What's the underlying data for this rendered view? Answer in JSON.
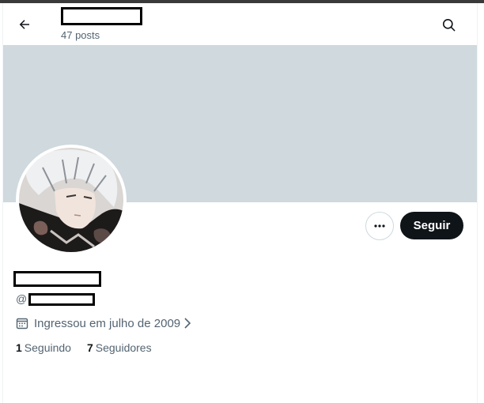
{
  "header": {
    "title": "",
    "post_count": "47 posts"
  },
  "profile": {
    "display_name": "",
    "handle_prefix": "@",
    "handle": "",
    "joined": "Ingressou em julho de 2009"
  },
  "actions": {
    "follow_label": "Seguir"
  },
  "stats": {
    "following_count": "1",
    "following_label": "Seguindo",
    "followers_count": "7",
    "followers_label": "Seguidores"
  },
  "icons": {
    "back": "arrow-left-icon",
    "search": "search-icon",
    "more": "more-dots-icon",
    "calendar": "calendar-icon",
    "chevron": "chevron-right-icon"
  },
  "colors": {
    "banner": "#cfd9de",
    "follow_button": "#0f1419",
    "secondary_text": "#536471"
  }
}
